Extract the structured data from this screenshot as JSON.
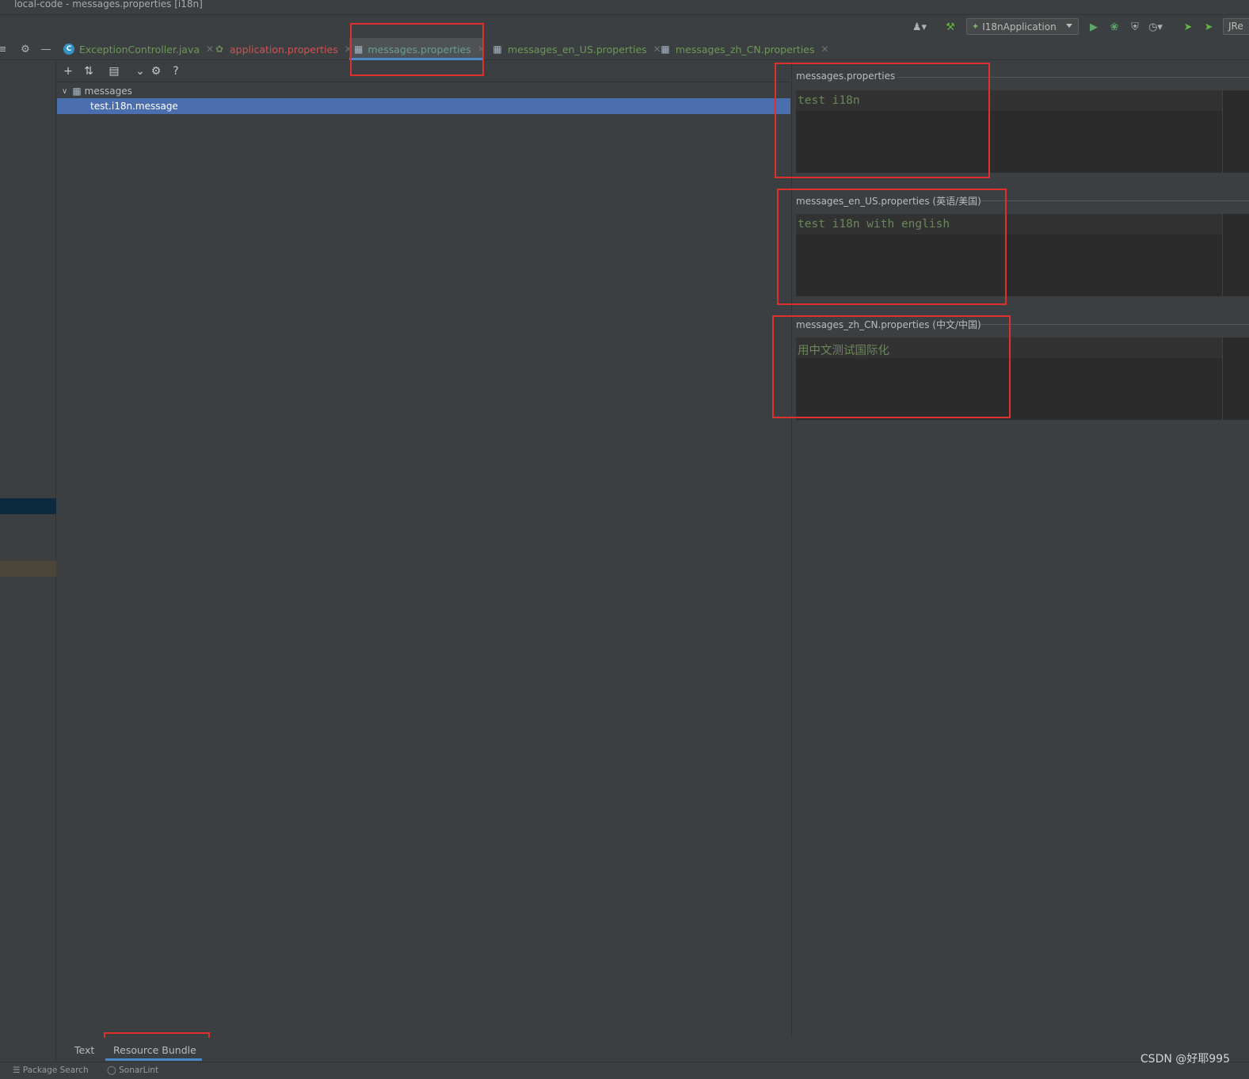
{
  "window": {
    "title": "local-code - messages.properties [i18n]"
  },
  "run_toolbar": {
    "run_config_label": "I18nApplication",
    "jre_label": "JRe",
    "icons": [
      "user-icon",
      "hammer-icon",
      "run-icon",
      "debug-icon",
      "coverage-icon",
      "profile-icon",
      "update-icon",
      "update-running-icon"
    ]
  },
  "tabs": [
    {
      "label": "ExceptionController.java",
      "icon": "class-icon",
      "icon_text": "C",
      "color": "#6a9955",
      "active": false
    },
    {
      "label": "application.properties",
      "icon": "spring-leaf-icon",
      "color": "#d25252",
      "active": false
    },
    {
      "label": "messages.properties",
      "icon": "resource-bundle-icon",
      "color": "#6a9e8e",
      "active": true
    },
    {
      "label": "messages_en_US.properties",
      "icon": "resource-bundle-icon",
      "color": "#6a9955",
      "active": false
    },
    {
      "label": "messages_zh_CN.properties",
      "icon": "resource-bundle-icon",
      "color": "#6a9955",
      "active": false
    }
  ],
  "editor_toolbar": {
    "buttons": [
      "add-icon",
      "sort-icon",
      "group-icon",
      "expand-icon",
      "settings-icon",
      "help-icon"
    ],
    "help_glyph": "?"
  },
  "tree": {
    "root_label": "messages",
    "selected_key": "test.i18n.message"
  },
  "locales": [
    {
      "title": "messages.properties",
      "value": "test i18n"
    },
    {
      "title": "messages_en_US.properties (英语/美国)",
      "value": "test i18n with english"
    },
    {
      "title": "messages_zh_CN.properties (中文/中国)",
      "value": "用中文测试国际化"
    }
  ],
  "bottom_tabs": [
    {
      "label": "Text",
      "active": false
    },
    {
      "label": "Resource Bundle",
      "active": true
    }
  ],
  "status_bar": {
    "items": [
      "Package Search",
      "SonarLint"
    ]
  },
  "watermark": "CSDN @好耶995",
  "colors": {
    "accent": "#4a88c7",
    "selection": "#4b6eaf",
    "annotation": "#e0302e",
    "value_text": "#6a8759"
  }
}
